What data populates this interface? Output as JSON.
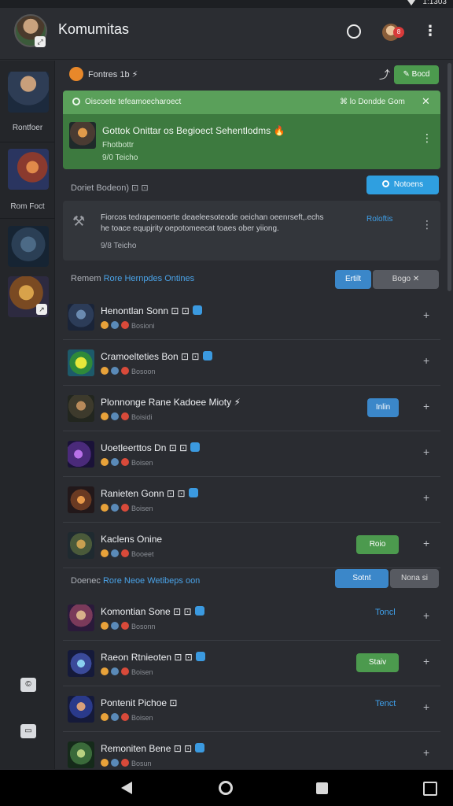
{
  "status_bar": {
    "time": "1:1303"
  },
  "header": {
    "title": "Komumitas",
    "notification_count": "8"
  },
  "sidebar": {
    "items": [
      {
        "label": "Rontfoer"
      },
      {
        "label": "Rom Foct"
      },
      {
        "label": ""
      },
      {
        "label": ""
      }
    ],
    "bottom_icons": [
      "©",
      "▭"
    ]
  },
  "section1": {
    "title": "Fontres 1b ⚡",
    "button": "✎ Bocd"
  },
  "green_bar": {
    "text": "Oiscoete tefeamoecharoect",
    "right_text": "⌘ lo Dondde Gom",
    "close": "✕"
  },
  "green_card": {
    "title": "Gottok Onittar os Begioect Sehentlodms 🔥",
    "subtitle": "Fhotbottr",
    "meta": "9/0 Teicho"
  },
  "section2": {
    "title": "Doriet Bodeon) ⊡ ⊡",
    "button": "Notoens"
  },
  "info_card": {
    "text_line1": "Fiorcos tedrapemoerte deaeleesoteode oeichan oeenrseft,.echs",
    "text_line2": "he toace equpjrity oepotomeecat toaes ober yiiong.",
    "link": "Roloftis",
    "meta": "9/8 Teicho"
  },
  "section3": {
    "title_prefix": "Remem",
    "title_accent": "Rore Hernpdes Ontines",
    "btn1": "Ertilt",
    "btn2": "Bogo ✕"
  },
  "rows1": [
    {
      "name": "Henontlan Sonn ⊡ ⊡",
      "meta": "Bosioni"
    },
    {
      "name": "Cramoelteties Bon ⊡ ⊡",
      "meta": "Bosoon"
    },
    {
      "name": "Plonnonge Rane Kadoee Mioty ⚡",
      "meta": "Boisidi",
      "button": "Inlin"
    },
    {
      "name": "Uoetleerttos Dn ⊡ ⊡",
      "meta": "Boisen"
    },
    {
      "name": "Ranieten Gonn ⊡ ⊡",
      "meta": "Boisen"
    },
    {
      "name": "Kaclens Onine",
      "meta": "Booeet",
      "button": "Roio"
    }
  ],
  "section4": {
    "title_prefix": "Doenec",
    "title_accent": "Rore Neoe Wetibeps oon",
    "btn1": "Sotnt",
    "btn2": "Nona si"
  },
  "rows2": [
    {
      "name": "Komontian Sone ⊡ ⊡",
      "meta": "Bosonn",
      "link": "Toncl"
    },
    {
      "name": "Raeon Rtnieoten ⊡ ⊡",
      "meta": "Boisen",
      "button": "Staiv"
    },
    {
      "name": "Pontenit Pichoe ⊡",
      "meta": "Boisen",
      "link": "Tenct"
    },
    {
      "name": "Remoniten Bene ⊡ ⊡",
      "meta": "Bosun"
    }
  ],
  "colors": {
    "accent": "#3b87c9",
    "green": "#3d7a3f",
    "bg": "#2a2c31"
  }
}
